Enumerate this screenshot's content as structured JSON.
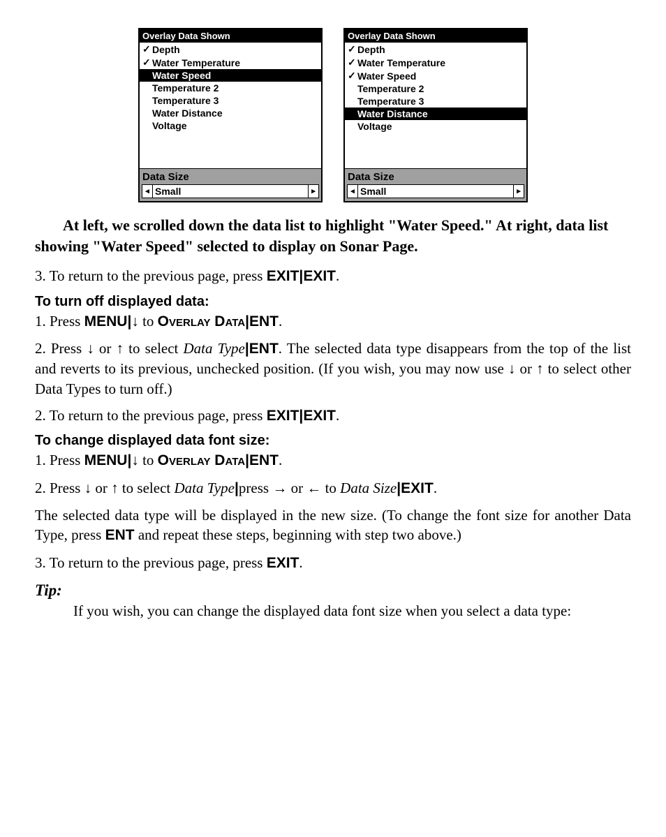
{
  "screens": {
    "title": "Overlay Data Shown",
    "left": {
      "items": [
        {
          "label": "Depth",
          "checked": true,
          "highlighted": false
        },
        {
          "label": "Water Temperature",
          "checked": true,
          "highlighted": false
        },
        {
          "label": "Water Speed",
          "checked": false,
          "highlighted": true
        },
        {
          "label": "Temperature 2",
          "checked": false,
          "highlighted": false
        },
        {
          "label": "Temperature 3",
          "checked": false,
          "highlighted": false
        },
        {
          "label": "Water Distance",
          "checked": false,
          "highlighted": false
        },
        {
          "label": "Voltage",
          "checked": false,
          "highlighted": false
        }
      ],
      "sizeLabel": "Data Size",
      "sizeValue": "Small"
    },
    "right": {
      "items": [
        {
          "label": "Depth",
          "checked": true,
          "highlighted": false
        },
        {
          "label": "Water Temperature",
          "checked": true,
          "highlighted": false
        },
        {
          "label": "Water Speed",
          "checked": true,
          "highlighted": false
        },
        {
          "label": "Temperature 2",
          "checked": false,
          "highlighted": false
        },
        {
          "label": "Temperature 3",
          "checked": false,
          "highlighted": false
        },
        {
          "label": "Water Distance",
          "checked": false,
          "highlighted": true
        },
        {
          "label": "Voltage",
          "checked": false,
          "highlighted": false
        }
      ],
      "sizeLabel": "Data Size",
      "sizeValue": "Small"
    }
  },
  "caption": "At left, we scrolled down the data list to highlight \"Water Speed.\" At right, data list showing \"Water Speed\" selected to display on Sonar Page.",
  "text": {
    "step3a_prefix": "3. To return to the previous page, press ",
    "exit": "EXIT",
    "pipe": "|",
    "period": ".",
    "heading_turnoff": "To turn off displayed data:",
    "step1_prefix": "1. Press ",
    "menu": "MENU",
    "to": " to ",
    "overlay": "Overlay Data",
    "ent": "ENT",
    "step2a_prefix": "2. Press ",
    "or": " or ",
    "to_select": " to select ",
    "datatype": "Data Type",
    "step2a_suffix": ". The selected data type disappears from the top of the list and reverts to its previous, unchecked position. (If you wish, you may now use ",
    "step2a_end": " to select other Data Types to turn off.)",
    "step2b": "2. To return to the previous page, press ",
    "heading_fontsize": "To change displayed data font size:",
    "step2c_mid": "press ",
    "datasize": "Data Size",
    "para_newsize": "The selected data type will be displayed in the new size. (To change the font size for another Data Type, press ",
    "para_newsize_end": " and repeat these steps, beginning with step two above.)",
    "step3b": "3. To return to the previous page, press ",
    "tip_label": "Tip:",
    "tip_body": "If you wish, you can change the displayed data font size when you select a data type:"
  },
  "arrows": {
    "down": "↓",
    "up": "↑",
    "right": "→",
    "left": "←",
    "tri_left": "◂",
    "tri_right": "▸"
  }
}
